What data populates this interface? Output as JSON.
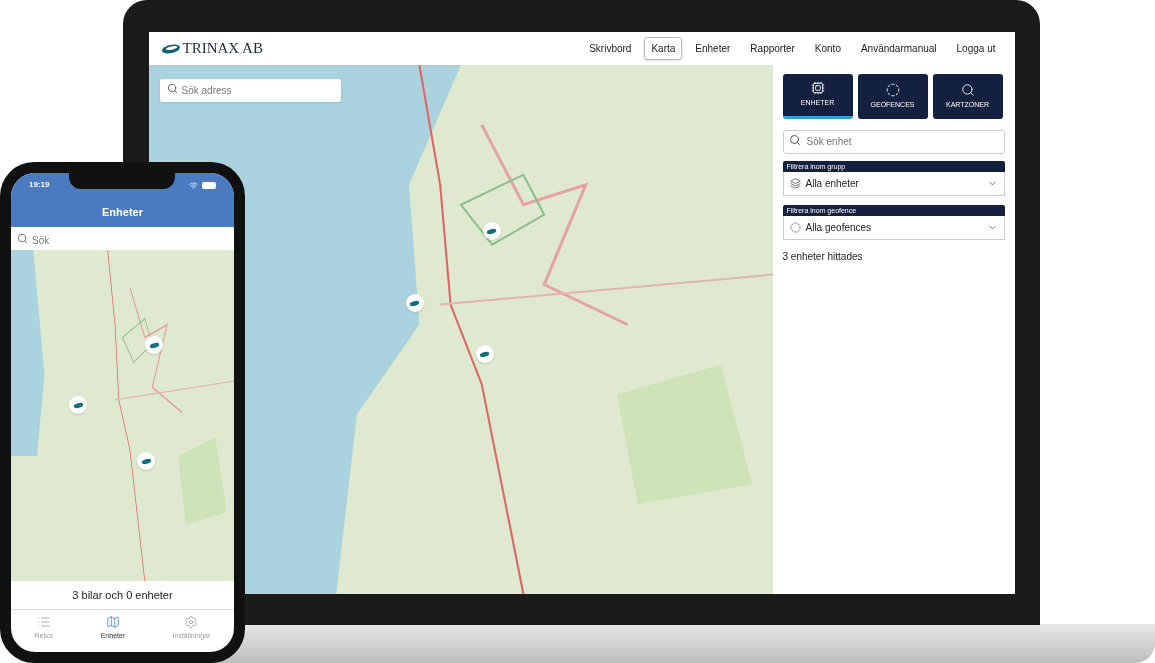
{
  "web_app": {
    "logo": "TRINAX AB",
    "nav": [
      {
        "label": "Skrivbord",
        "selected": false
      },
      {
        "label": "Karta",
        "selected": true
      },
      {
        "label": "Enheter",
        "selected": false
      },
      {
        "label": "Rapporter",
        "selected": false
      },
      {
        "label": "Konto",
        "selected": false
      },
      {
        "label": "Användarmanual",
        "selected": false
      },
      {
        "label": "Logga ut",
        "selected": false
      }
    ],
    "map_search": {
      "placeholder": "Sök adress"
    },
    "mode_tabs": [
      {
        "label": "ENHETER",
        "kind": "chip",
        "selected": true
      },
      {
        "label": "GEOFENCES",
        "kind": "ring",
        "selected": false
      },
      {
        "label": "KARTZONER",
        "kind": "search",
        "selected": false
      }
    ],
    "unit_search": {
      "placeholder": "Sök enhet"
    },
    "filters": [
      {
        "label": "Filtrera inom grupp",
        "value": "Alla enheter",
        "kind": "layers"
      },
      {
        "label": "Filtrera inom geofence",
        "value": "Alla geofences",
        "kind": "ring"
      }
    ],
    "result_count": "3 enheter hittades"
  },
  "phone_app": {
    "time": "19:19",
    "title": "Enheter",
    "search": {
      "placeholder": "Sök"
    },
    "summary": "3 bilar och 0 enheter",
    "tabs": [
      {
        "label": "Resor",
        "kind": "list",
        "selected": false
      },
      {
        "label": "Enheter",
        "kind": "map",
        "selected": true
      },
      {
        "label": "Inställningar",
        "kind": "gear",
        "selected": false
      }
    ]
  }
}
